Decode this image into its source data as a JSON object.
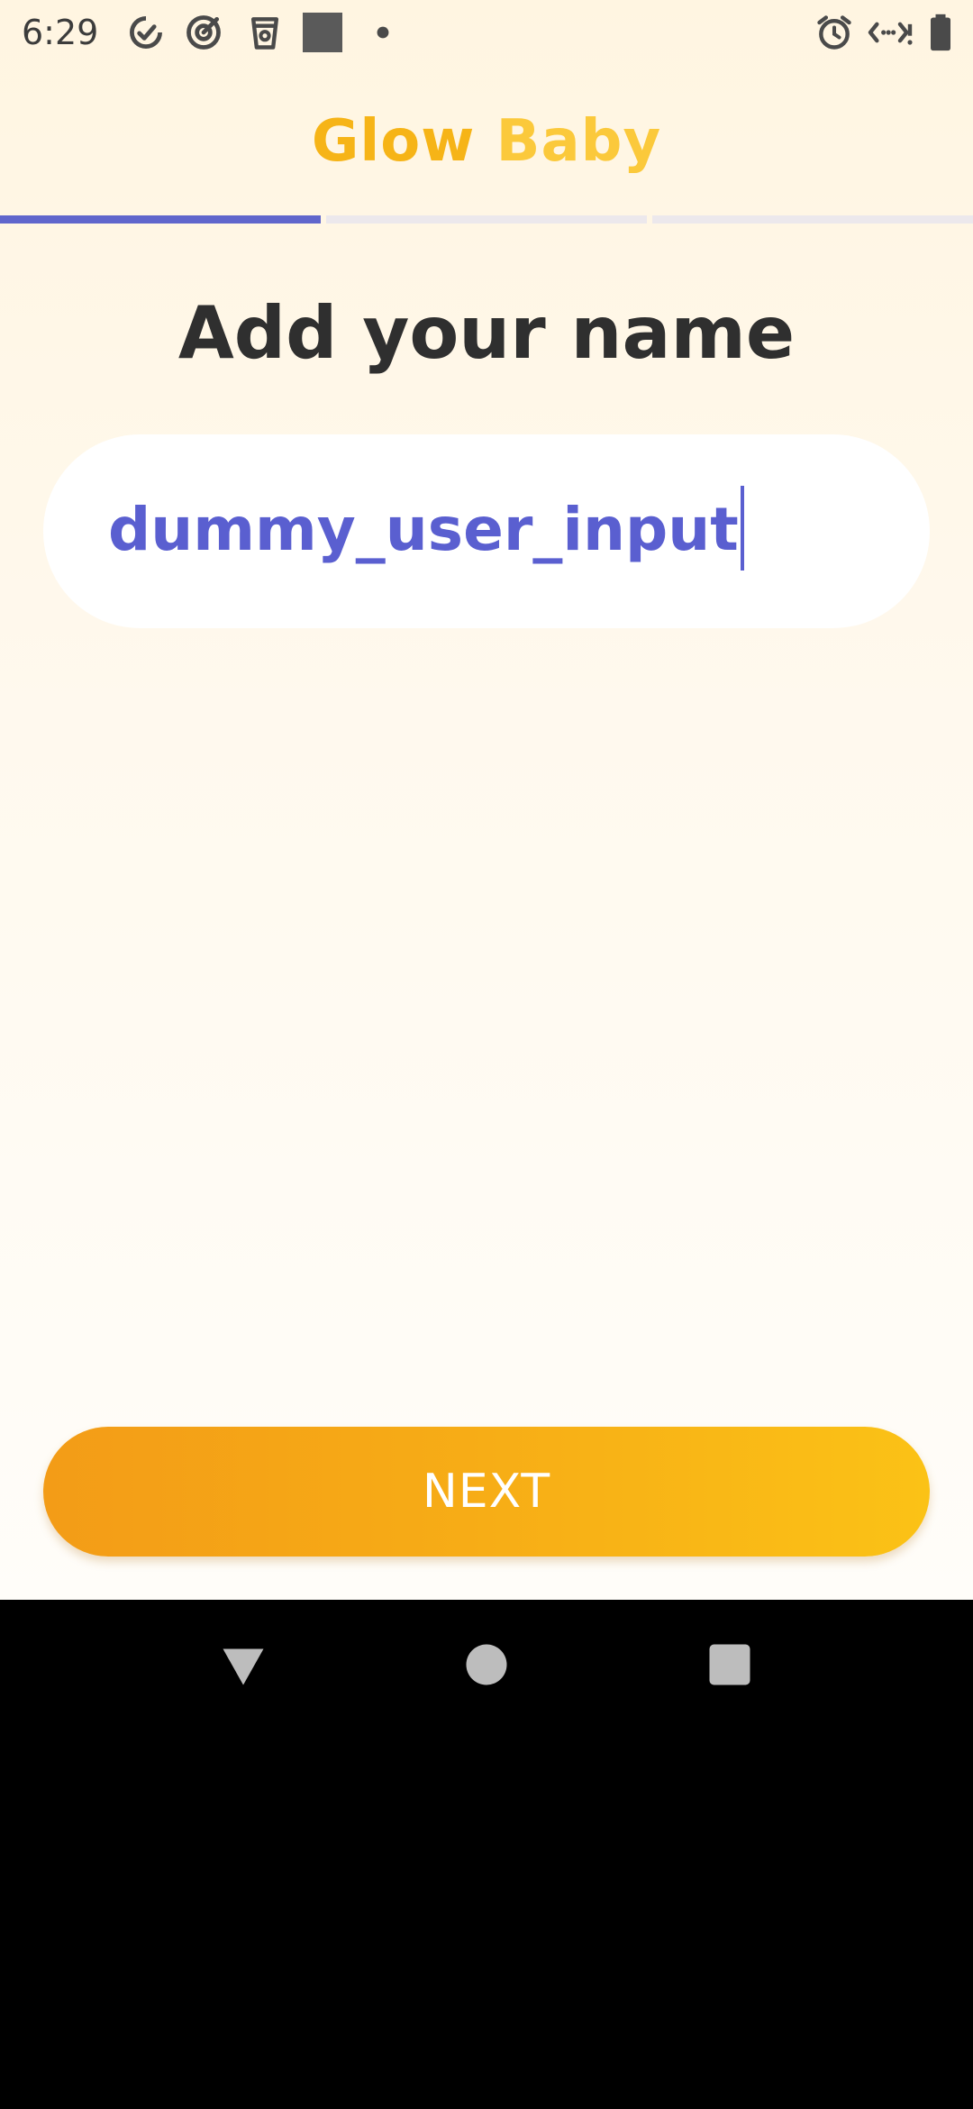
{
  "status_bar": {
    "time": "6:29",
    "left_icons": [
      "check-circle-icon",
      "target-icon",
      "cup-icon",
      "square-icon",
      "dot-icon"
    ],
    "right_icons": [
      "alarm-icon",
      "data-transfer-icon",
      "battery-icon"
    ]
  },
  "header": {
    "logo_part_1": "Glow",
    "logo_part_2": "Baby",
    "logo_color_1": "#f6b417",
    "logo_color_2": "#fbc93b"
  },
  "progress": {
    "current_step": 1,
    "total_steps": 3,
    "active_color": "#6066cc"
  },
  "main": {
    "title": "Add your name",
    "name_input": {
      "value": "dummy_user_input",
      "text_color": "#5a5fd0"
    }
  },
  "footer": {
    "next_label": "NEXT",
    "button_color_start": "#f39c17",
    "button_color_end": "#fbc216"
  },
  "nav_bar": {
    "buttons": [
      "back-icon",
      "home-icon",
      "recents-icon"
    ]
  }
}
